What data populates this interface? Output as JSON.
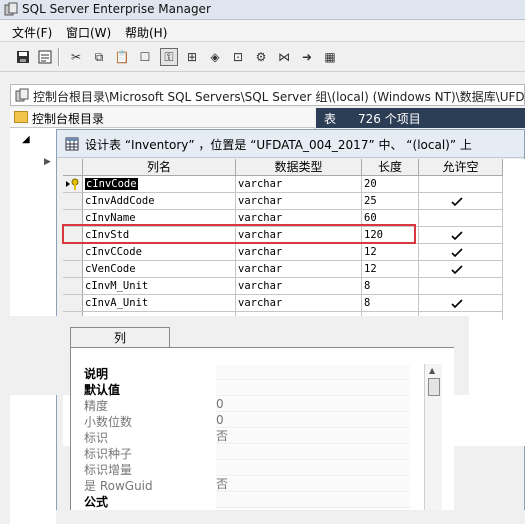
{
  "app": {
    "title": "SQL Server Enterprise Manager",
    "icon": "app-icon"
  },
  "menu": {
    "items": [
      {
        "label": "文件(F)"
      },
      {
        "label": "窗口(W)"
      },
      {
        "label": "帮助(H)"
      }
    ]
  },
  "toolbar": {
    "icons": [
      "save-icon",
      "properties-icon",
      "cut-icon",
      "copy-icon",
      "paste-icon",
      "key-icon",
      "table-relations-icon",
      "index-icon",
      "check-constraint-icon",
      "triggers-icon",
      "tree-icon",
      "arrow-icon",
      "grid-icon"
    ]
  },
  "path": {
    "text": "控制台根目录\\Microsoft SQL Servers\\SQL Server 组\\(local) (Windows NT)\\数据库\\UFDA"
  },
  "tree": {
    "header": "控制台根目录"
  },
  "right_header": {
    "label": "表",
    "count": "726 个项目"
  },
  "dialog": {
    "title": "设计表 “Inventory” ，位置是 “UFDATA_004_2017” 中、 “(local)” 上"
  },
  "grid": {
    "headers": [
      "列名",
      "数据类型",
      "长度",
      "允许空"
    ],
    "rows": [
      {
        "name": "cInvCode",
        "type": "varchar",
        "length": "20",
        "nullable": false,
        "selected": true,
        "key": true
      },
      {
        "name": "cInvAddCode",
        "type": "varchar",
        "length": "25",
        "nullable": true
      },
      {
        "name": "cInvName",
        "type": "varchar",
        "length": "60",
        "nullable": false
      },
      {
        "name": "cInvStd",
        "type": "varchar",
        "length": "120",
        "nullable": true
      },
      {
        "name": "cInvCCode",
        "type": "varchar",
        "length": "12",
        "nullable": true
      },
      {
        "name": "cVenCode",
        "type": "varchar",
        "length": "12",
        "nullable": true
      },
      {
        "name": "cInvM_Unit",
        "type": "varchar",
        "length": "8",
        "nullable": false
      },
      {
        "name": "cInvA_Unit",
        "type": "varchar",
        "length": "8",
        "nullable": true
      }
    ]
  },
  "properties": {
    "tab": "列",
    "rows": [
      {
        "label": "说明",
        "value": "",
        "style": "bold"
      },
      {
        "label": "默认值",
        "value": "",
        "style": "bold"
      },
      {
        "label": "精度",
        "value": "0",
        "style": "dim"
      },
      {
        "label": "小数位数",
        "value": "0",
        "style": "dim"
      },
      {
        "label": "标识",
        "value": "否",
        "style": "dim"
      },
      {
        "label": "标识种子",
        "value": "",
        "style": "dim"
      },
      {
        "label": "标识增量",
        "value": "",
        "style": "dim"
      },
      {
        "label": "是 RowGuid",
        "value": "否",
        "style": "dim"
      },
      {
        "label": "公式",
        "value": "",
        "style": "bold"
      }
    ]
  }
}
